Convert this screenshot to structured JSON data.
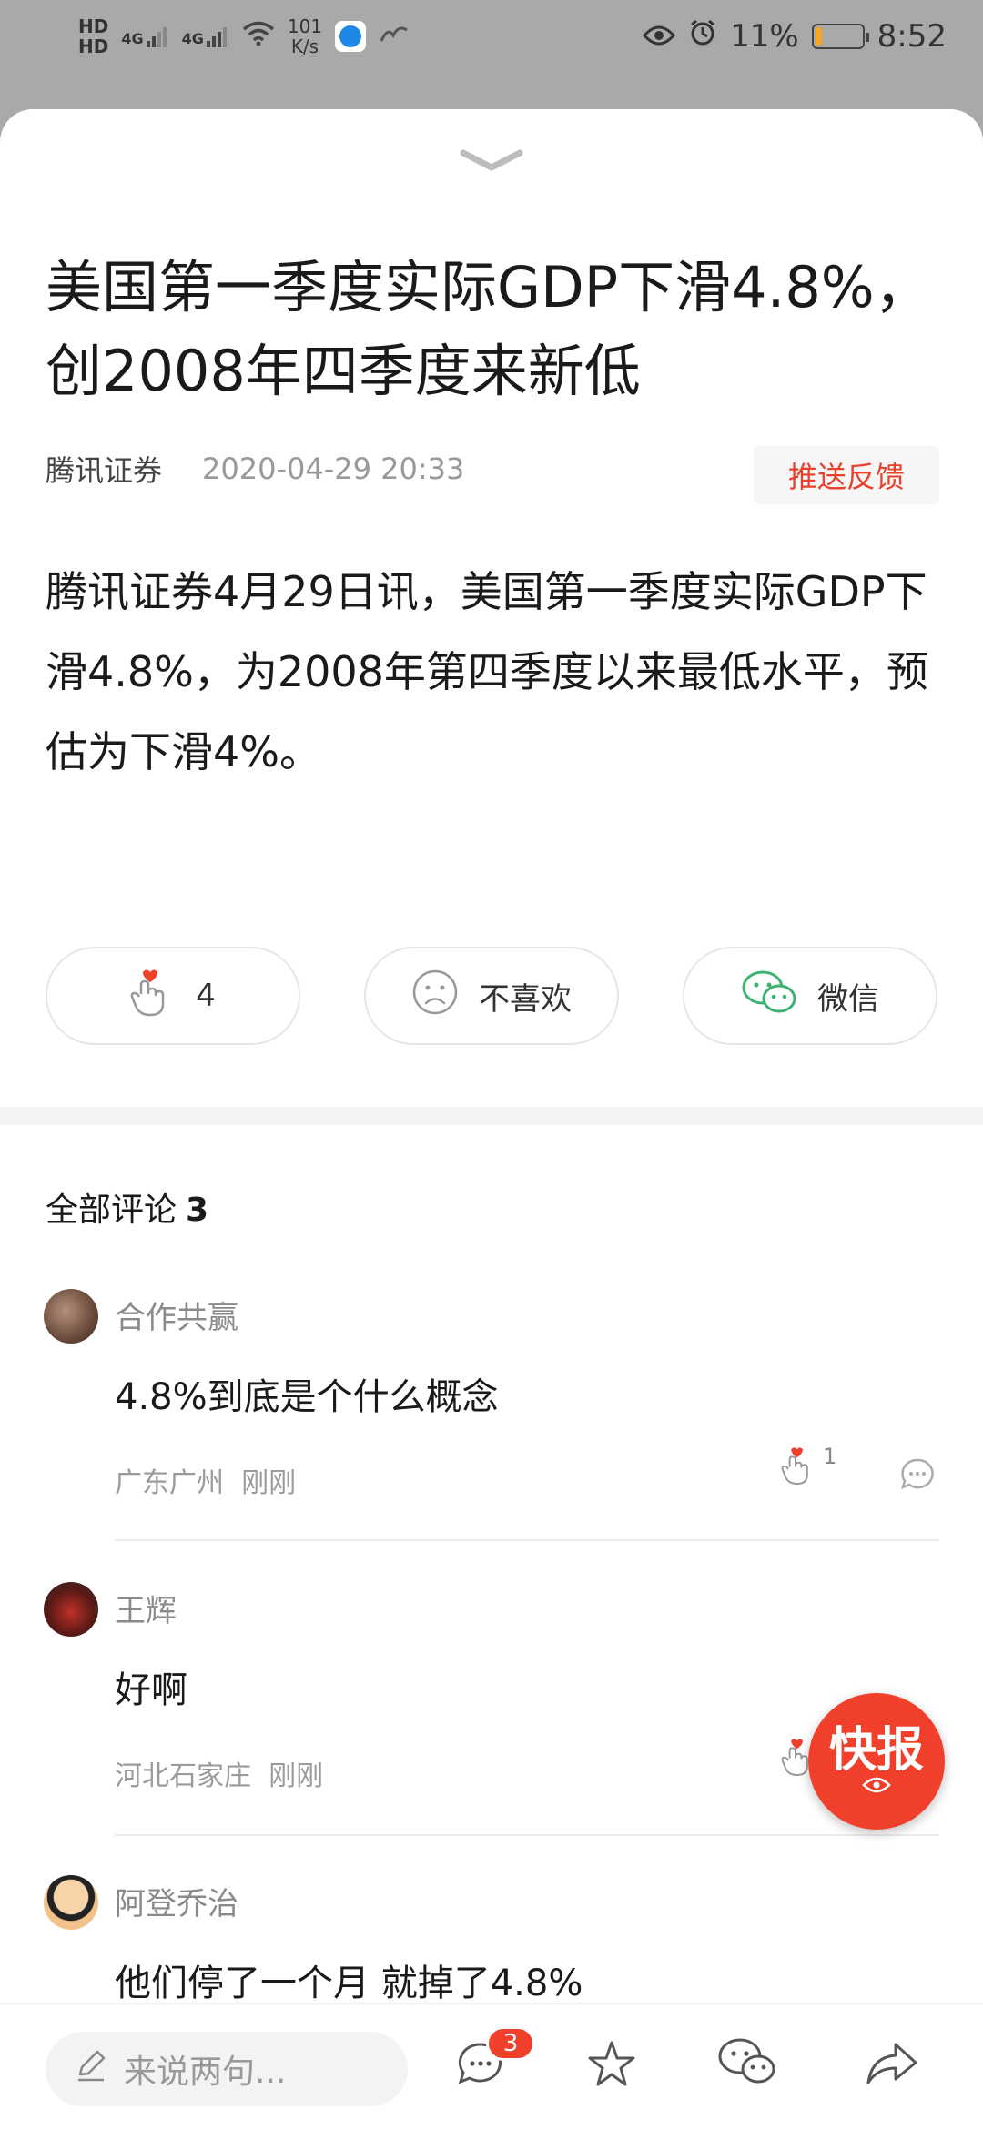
{
  "status_bar": {
    "hd1": "HD",
    "hd2": "HD",
    "net1": "4G",
    "net2": "4G",
    "speed_value": "101",
    "speed_unit": "K/s",
    "battery_pct": "11%",
    "time": "8:52",
    "battery_fill": 0.11,
    "battery_color": "#f5a623"
  },
  "article": {
    "title": "美国第一季度实际GDP下滑4.8%，创2008年四季度来新低",
    "source": "腾讯证券",
    "time": "2020-04-29 20:33",
    "feedback_label": "推送反馈",
    "body": "腾讯证券4月29日讯，美国第一季度实际GDP下滑4.8%，为2008年第四季度以来最低水平，预估为下滑4%。"
  },
  "actions": {
    "like_count": "4",
    "dislike_label": "不喜欢",
    "wechat_label": "微信"
  },
  "comments": {
    "header_label": "全部评论",
    "count": "3",
    "items": [
      {
        "name": "合作共赢",
        "text": "4.8%到底是个什么概念",
        "location": "广东广州",
        "time": "刚刚",
        "likes": "1"
      },
      {
        "name": "王辉",
        "text": "好啊",
        "location": "河北石家庄",
        "time": "刚刚",
        "likes": ""
      },
      {
        "name": "阿登乔治",
        "text": "他们停了一个月 就掉了4.8%",
        "location": "",
        "time": "",
        "likes": ""
      }
    ]
  },
  "floating": {
    "kuaibao_label": "快报"
  },
  "bottom_bar": {
    "input_placeholder": "来说两句...",
    "comment_badge": "3"
  },
  "colors": {
    "accent_red": "#f0402c",
    "feedback_red": "#e8412c",
    "wechat_green": "#3cb371"
  }
}
